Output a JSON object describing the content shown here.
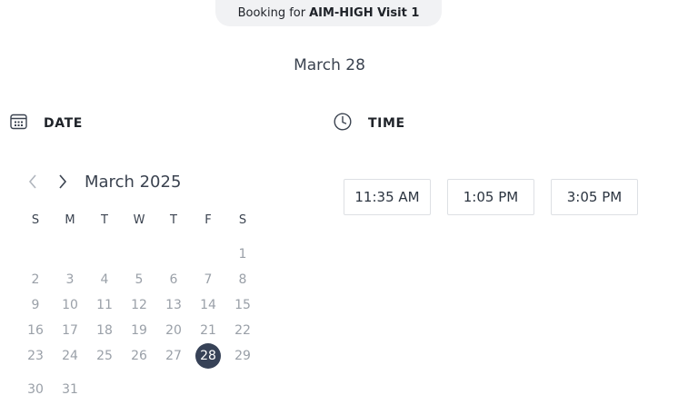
{
  "banner": {
    "prefix": "Booking for",
    "event": "AIM-HIGH Visit 1"
  },
  "selected_date_title": "March 28",
  "date_section": {
    "label": "DATE",
    "icon": "calendar-icon"
  },
  "time_section": {
    "label": "TIME",
    "icon": "clock-icon"
  },
  "calendar": {
    "month_label": "March 2025",
    "prev_icon": "chevron-left-icon",
    "next_icon": "chevron-right-icon",
    "weekdays": [
      "S",
      "M",
      "T",
      "W",
      "T",
      "F",
      "S"
    ],
    "weeks": [
      [
        "",
        "",
        "",
        "",
        "",
        "",
        "1"
      ],
      [
        "2",
        "3",
        "4",
        "5",
        "6",
        "7",
        "8"
      ],
      [
        "9",
        "10",
        "11",
        "12",
        "13",
        "14",
        "15"
      ],
      [
        "16",
        "17",
        "18",
        "19",
        "20",
        "21",
        "22"
      ],
      [
        "23",
        "24",
        "25",
        "26",
        "27",
        "28",
        "29"
      ],
      [
        "30",
        "31",
        "",
        "",
        "",
        "",
        ""
      ]
    ],
    "selected_day": "28"
  },
  "time_slots": [
    "11:35 AM",
    "1:05 PM",
    "3:05 PM"
  ],
  "colors": {
    "selected_day_bg": "#374257",
    "muted_day": "#9aa0a8",
    "banner_bg": "#f1f2f4"
  }
}
